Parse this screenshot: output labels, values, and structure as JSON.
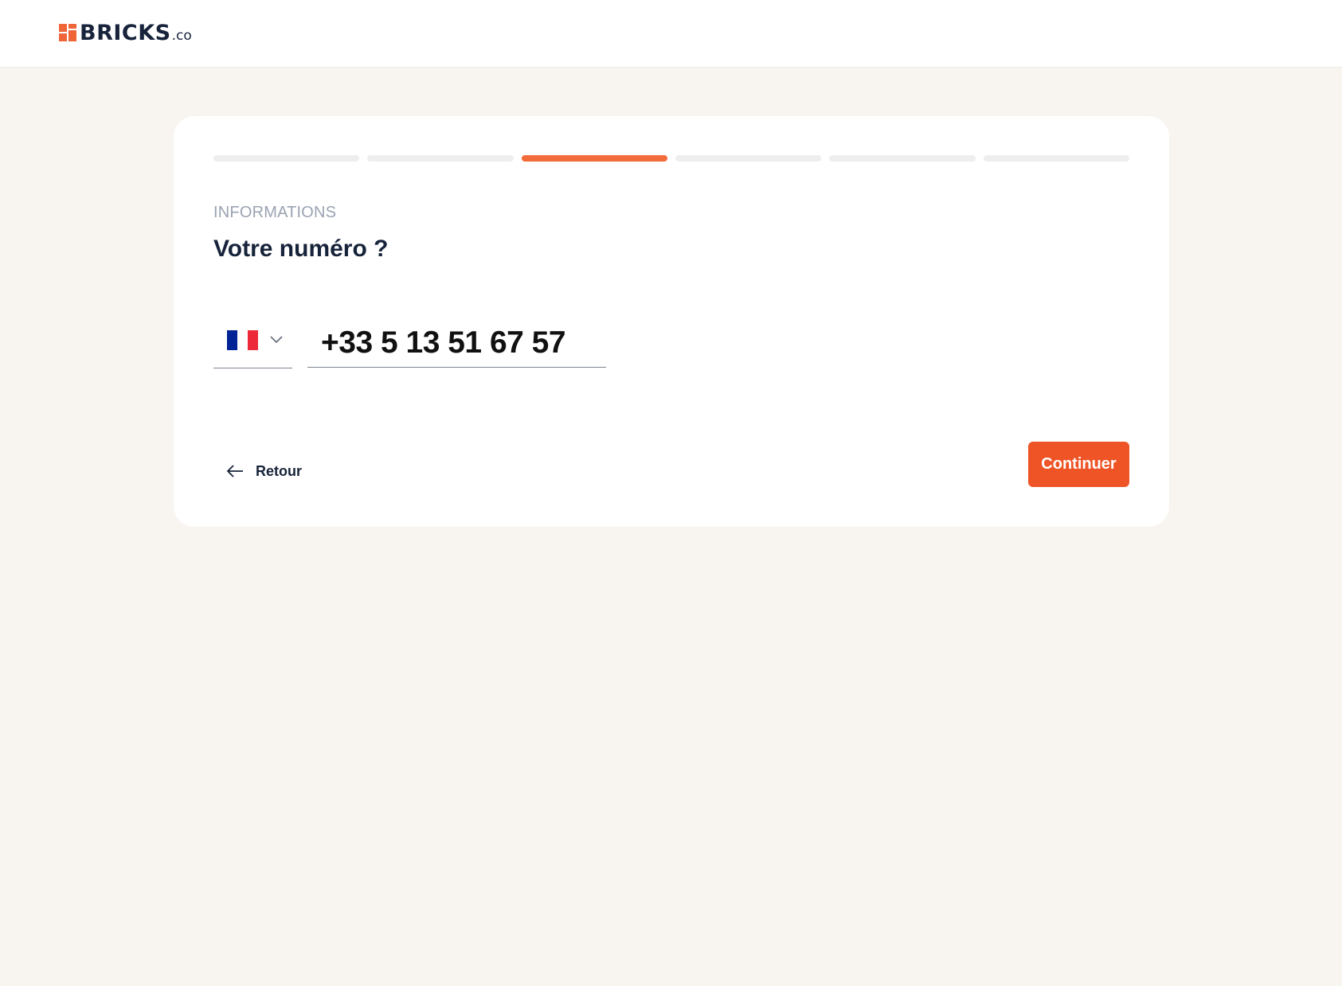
{
  "header": {
    "logo_text": "BRICKS",
    "logo_suffix": ".co"
  },
  "progress": {
    "total_steps": 6,
    "current_step": 3
  },
  "form": {
    "overline": "INFORMATIONS",
    "title": "Votre numéro ?",
    "country": {
      "selected": "France",
      "icon": "france-flag-icon"
    },
    "phone_value": "+33 5 13 51 67 57"
  },
  "actions": {
    "back_label": "Retour",
    "continue_label": "Continuer"
  },
  "colors": {
    "accent": "#f26b3a",
    "button": "#ef5426",
    "background": "#f8f5f1",
    "text": "#17233a",
    "muted": "#9aa3b2"
  }
}
